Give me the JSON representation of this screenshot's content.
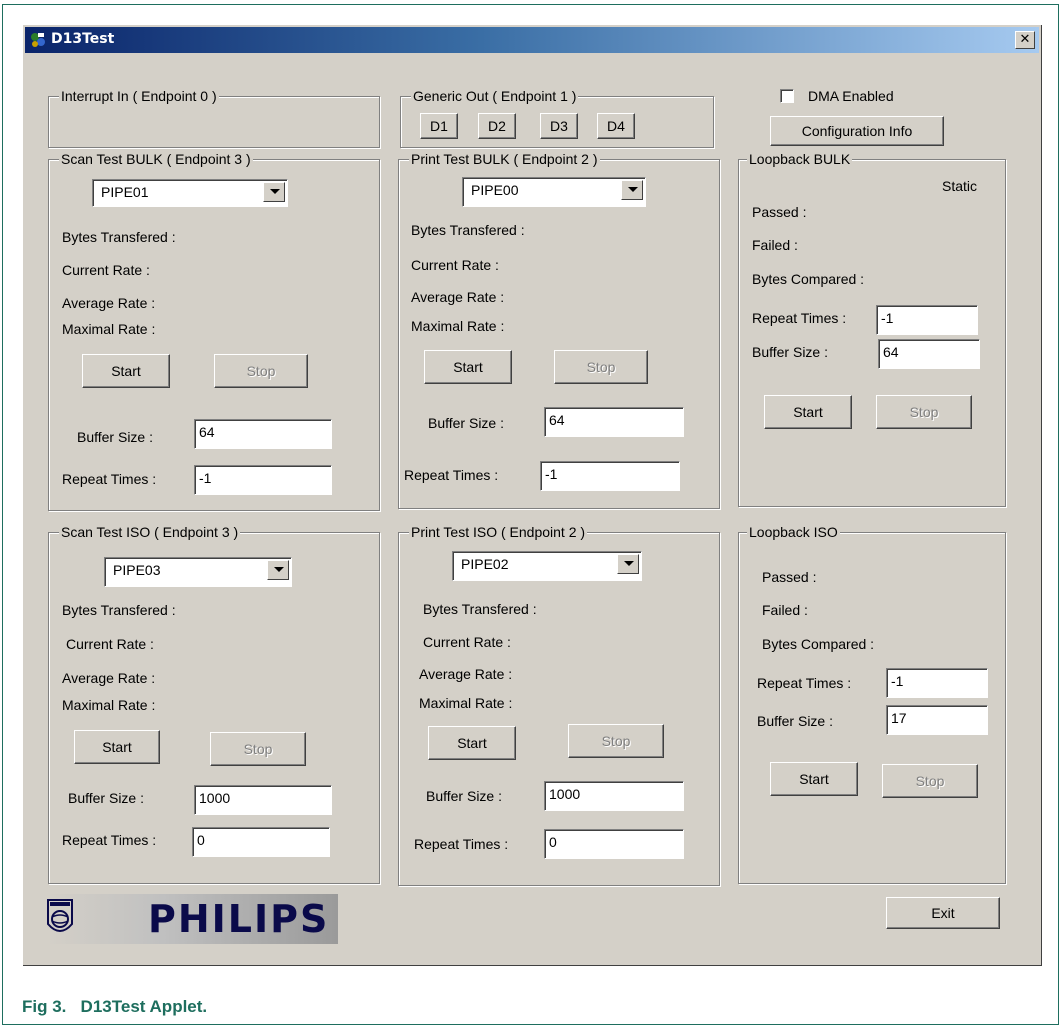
{
  "window": {
    "title": "D13Test",
    "close_label": "✕"
  },
  "interrupt_in": {
    "legend": "Interrupt In ( Endpoint 0 )"
  },
  "generic_out": {
    "legend": "Generic Out ( Endpoint 1 )",
    "buttons": [
      "D1",
      "D2",
      "D3",
      "D4"
    ]
  },
  "dma": {
    "label": "DMA Enabled",
    "checked": false
  },
  "config_button": "Configuration Info",
  "labels": {
    "bytes_transfered": "Bytes Transfered :",
    "current_rate": "Current Rate :",
    "average_rate": "Average Rate :",
    "maximal_rate": "Maximal Rate :",
    "buffer_size": "Buffer Size :",
    "repeat_times": "Repeat Times :",
    "passed": "Passed :",
    "failed": "Failed :",
    "bytes_compared": "Bytes Compared :",
    "start": "Start",
    "stop": "Stop"
  },
  "scan_bulk": {
    "legend": "Scan Test BULK ( Endpoint 3 )",
    "pipe": "PIPE01",
    "buffer_size": "64",
    "repeat_times": "-1"
  },
  "print_bulk": {
    "legend": "Print Test BULK ( Endpoint 2 )",
    "pipe": "PIPE00",
    "buffer_size": "64",
    "repeat_times": "-1"
  },
  "loop_bulk": {
    "legend": "Loopback BULK",
    "status": "Static",
    "repeat_times": "-1",
    "buffer_size": "64"
  },
  "scan_iso": {
    "legend": "Scan Test ISO ( Endpoint 3 )",
    "pipe": "PIPE03",
    "buffer_size": "1000",
    "repeat_times": "0"
  },
  "print_iso": {
    "legend": "Print Test ISO ( Endpoint 2 )",
    "pipe": "PIPE02",
    "buffer_size": "1000",
    "repeat_times": "0"
  },
  "loop_iso": {
    "legend": "Loopback ISO",
    "repeat_times": "-1",
    "buffer_size": "17"
  },
  "logo": {
    "text": "PHILIPS"
  },
  "exit_button": "Exit",
  "caption": "Fig 3.   D13Test Applet."
}
